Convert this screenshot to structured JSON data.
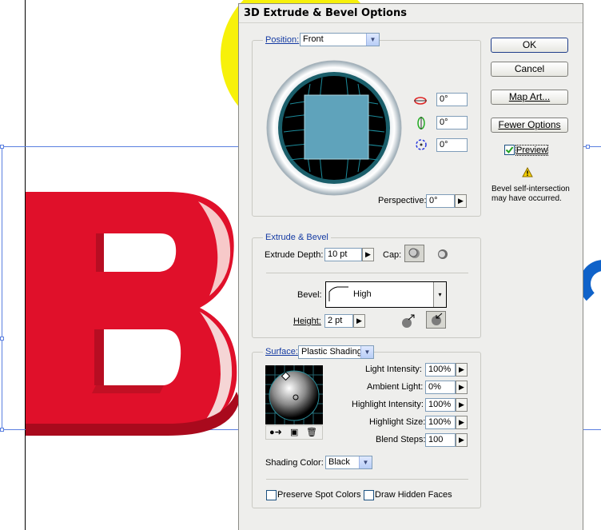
{
  "dialog": {
    "title": "3D Extrude & Bevel Options"
  },
  "position": {
    "label": "Position:",
    "preset": "Front",
    "rotation_x": "0°",
    "rotation_y": "0°",
    "rotation_z": "0°",
    "perspective_label": "Perspective:",
    "perspective_value": "0°"
  },
  "buttons": {
    "ok": "OK",
    "cancel": "Cancel",
    "map_art": "Map Art...",
    "fewer_options": "Fewer Options"
  },
  "preview": {
    "label": "Preview",
    "checked": true
  },
  "warning": {
    "text_line1": "Bevel self-intersection",
    "text_line2": "may have occurred."
  },
  "extrude": {
    "legend": "Extrude & Bevel",
    "depth_label": "Extrude Depth:",
    "depth_value": "10 pt",
    "cap_label": "Cap:",
    "bevel_label": "Bevel:",
    "bevel_value": "High",
    "height_label": "Height:",
    "height_value": "2 pt"
  },
  "surface": {
    "label": "Surface:",
    "value": "Plastic Shading",
    "light_intensity_label": "Light Intensity:",
    "light_intensity_value": "100%",
    "ambient_light_label": "Ambient Light:",
    "ambient_light_value": "0%",
    "highlight_intensity_label": "Highlight Intensity:",
    "highlight_intensity_value": "100%",
    "highlight_size_label": "Highlight Size:",
    "highlight_size_value": "100%",
    "blend_steps_label": "Blend Steps:",
    "blend_steps_value": "100",
    "shading_color_label": "Shading Color:",
    "shading_color_value": "Black"
  },
  "options": {
    "preserve_spot_colors": "Preserve Spot Colors",
    "draw_hidden_faces": "Draw Hidden Faces"
  },
  "colors": {
    "legend_blue": "#153ba3",
    "cube_face": "#5fa3bb",
    "letter_red": "#e0102a",
    "yellow_shape": "#f7f10a",
    "blue_shape": "#0f62c9"
  }
}
